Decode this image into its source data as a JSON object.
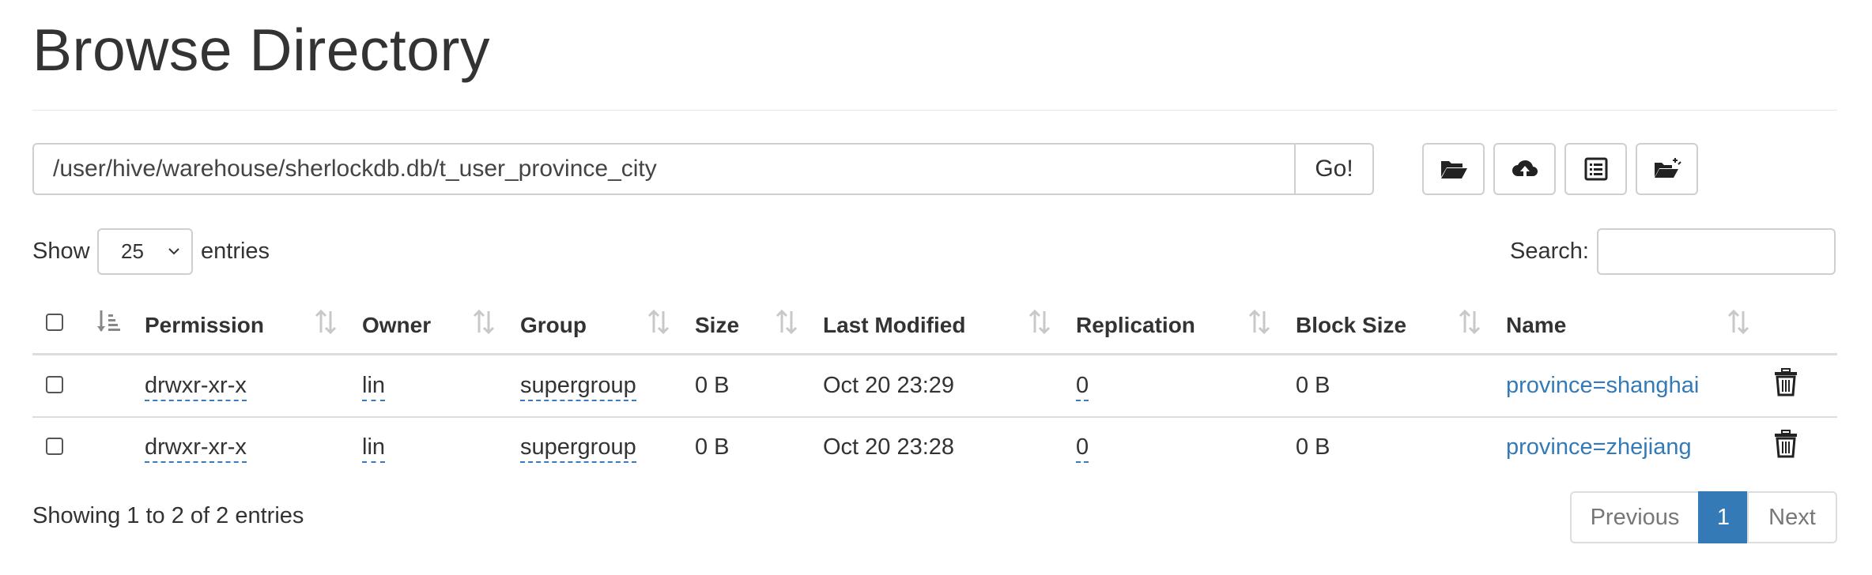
{
  "page": {
    "title": "Browse Directory"
  },
  "path_bar": {
    "value": "/user/hive/warehouse/sherlockdb.db/t_user_province_city",
    "go_label": "Go!"
  },
  "toolbar": {
    "icons": [
      "folder-open-icon",
      "cloud-upload-icon",
      "list-alt-icon",
      "folder-cut-icon"
    ]
  },
  "length": {
    "show_label": "Show",
    "value": "25",
    "entries_label": "entries"
  },
  "search": {
    "label": "Search:",
    "value": ""
  },
  "table": {
    "columns": [
      "Permission",
      "Owner",
      "Group",
      "Size",
      "Last Modified",
      "Replication",
      "Block Size",
      "Name"
    ],
    "rows": [
      {
        "permission": "drwxr-xr-x",
        "owner": "lin",
        "group": "supergroup",
        "size": "0 B",
        "last_modified": "Oct 20 23:29",
        "replication": "0",
        "block_size": "0 B",
        "name": "province=shanghai"
      },
      {
        "permission": "drwxr-xr-x",
        "owner": "lin",
        "group": "supergroup",
        "size": "0 B",
        "last_modified": "Oct 20 23:28",
        "replication": "0",
        "block_size": "0 B",
        "name": "province=zhejiang"
      }
    ]
  },
  "footer": {
    "info": "Showing 1 to 2 of 2 entries",
    "previous": "Previous",
    "current_page": "1",
    "next": "Next"
  },
  "colors": {
    "link": "#337ab7",
    "active_page": "#337ab7",
    "text": "#333333"
  }
}
